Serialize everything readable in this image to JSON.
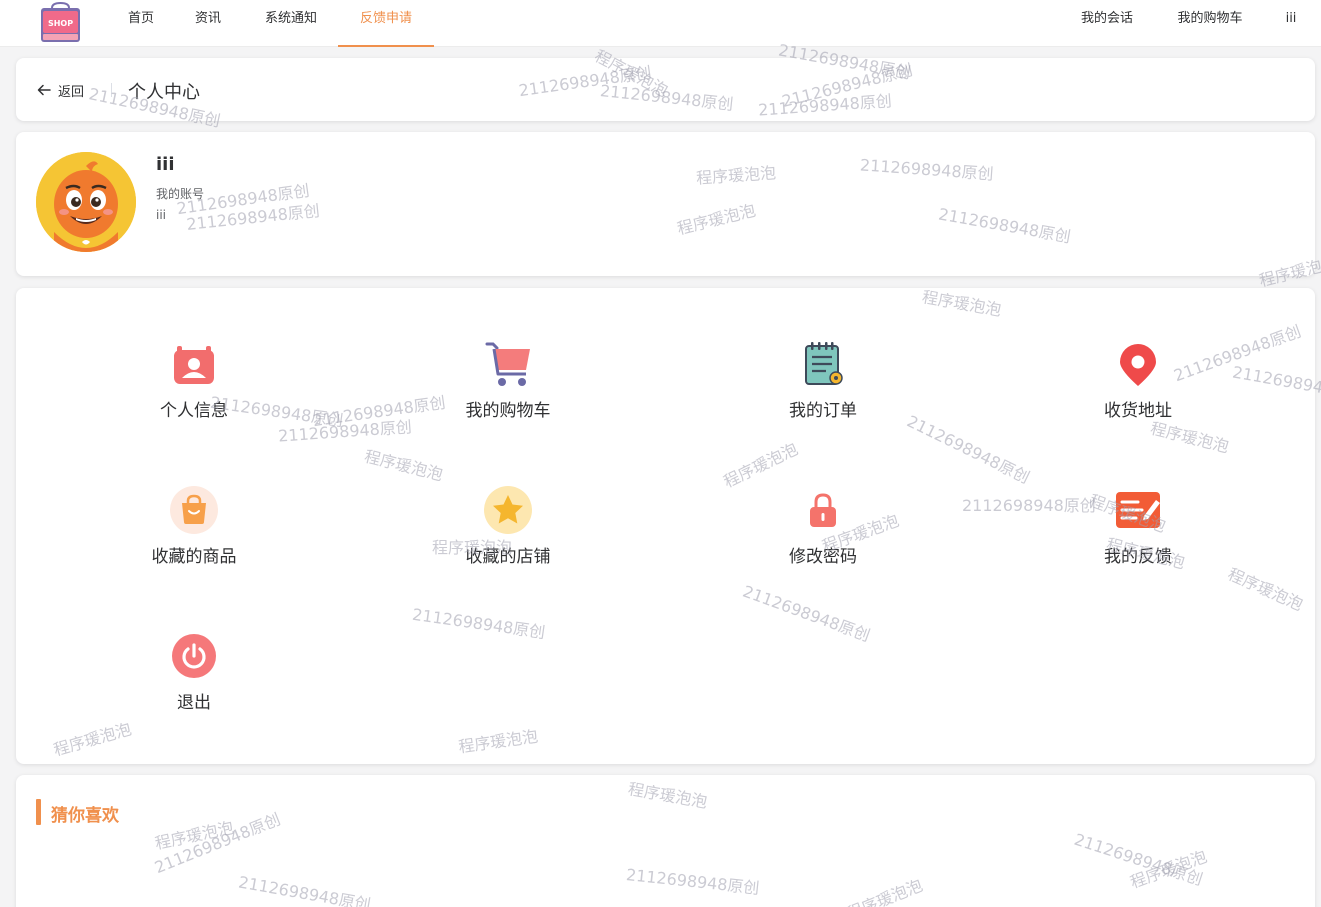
{
  "nav": {
    "logo_text": "SHOP",
    "left_items": [
      {
        "label": "首页"
      },
      {
        "label": "资讯"
      },
      {
        "label": "系统通知"
      },
      {
        "label": "反馈申请",
        "active": true
      }
    ],
    "right_items": [
      {
        "label": "我的会话"
      },
      {
        "label": "我的购物车"
      },
      {
        "label": "iii"
      }
    ]
  },
  "header_card": {
    "back_label": "返回",
    "title": "个人中心"
  },
  "profile": {
    "username": "iii",
    "account_label": "我的账号",
    "account_value": "iii"
  },
  "menu": [
    {
      "label": "个人信息",
      "icon": "person-card-icon",
      "color": "#f26d6d"
    },
    {
      "label": "我的购物车",
      "icon": "shopping-cart-icon",
      "color": "#f47c7c"
    },
    {
      "label": "我的订单",
      "icon": "order-notepad-icon",
      "color": "#7fc6bd"
    },
    {
      "label": "收货地址",
      "icon": "location-pin-icon",
      "color": "#ef4a4a"
    },
    {
      "label": "收藏的商品",
      "icon": "shopping-bag-icon",
      "color": "#f7a04a"
    },
    {
      "label": "收藏的店铺",
      "icon": "star-icon",
      "color": "#f5b62e"
    },
    {
      "label": "修改密码",
      "icon": "lock-icon",
      "color": "#f4736b"
    },
    {
      "label": "我的反馈",
      "icon": "feedback-edit-icon",
      "color": "#f25c36"
    },
    {
      "label": "退出",
      "icon": "power-icon",
      "color": "#f5787a"
    }
  ],
  "recommend": {
    "title": "猜你喜欢"
  },
  "watermarks": {
    "a": "2112698948原创",
    "b": "程序瑗泡泡"
  },
  "colors": {
    "accent": "#f0904d",
    "background": "#f4f4f5"
  }
}
